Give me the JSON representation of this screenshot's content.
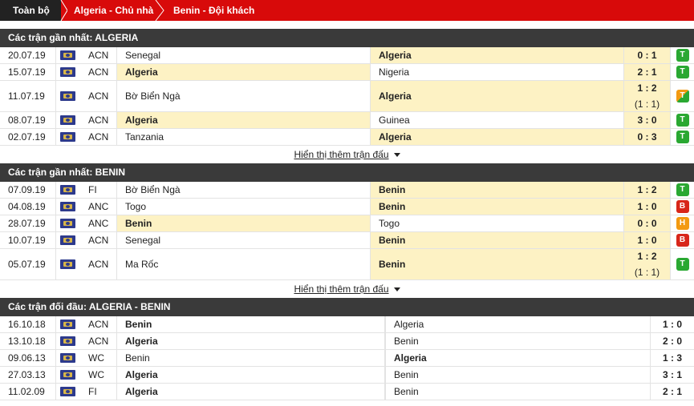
{
  "tabs": [
    {
      "label": "Toàn bộ"
    },
    {
      "label": "Algeria - Chủ nhà"
    },
    {
      "label": "Benin - Đội khách"
    }
  ],
  "sections": [
    {
      "title": "Các trận gần nhất: ALGERIA",
      "more": "Hiển thị thêm trận đấu",
      "rows": [
        {
          "date": "20.07.19",
          "league": "ACN",
          "home": "Senegal",
          "away": "Algeria",
          "score": "0 : 1",
          "sub": "",
          "result": "T",
          "hl": "away"
        },
        {
          "date": "15.07.19",
          "league": "ACN",
          "home": "Algeria",
          "away": "Nigeria",
          "score": "2 : 1",
          "sub": "",
          "result": "T",
          "hl": "home"
        },
        {
          "date": "11.07.19",
          "league": "ACN",
          "home": "Bờ Biển Ngà",
          "away": "Algeria",
          "score": "1 : 2",
          "sub": "(1 : 1)",
          "result": "T",
          "hl": "away"
        },
        {
          "date": "08.07.19",
          "league": "ACN",
          "home": "Algeria",
          "away": "Guinea",
          "score": "3 : 0",
          "sub": "",
          "result": "T",
          "hl": "home"
        },
        {
          "date": "02.07.19",
          "league": "ACN",
          "home": "Tanzania",
          "away": "Algeria",
          "score": "0 : 3",
          "sub": "",
          "result": "T",
          "hl": "away"
        }
      ]
    },
    {
      "title": "Các trận gần nhất: BENIN",
      "more": "Hiển thị thêm trận đấu",
      "rows": [
        {
          "date": "07.09.19",
          "league": "FI",
          "home": "Bờ Biển Ngà",
          "away": "Benin",
          "score": "1 : 2",
          "sub": "",
          "result": "T",
          "hl": "away"
        },
        {
          "date": "04.08.19",
          "league": "ANC",
          "home": "Togo",
          "away": "Benin",
          "score": "1 : 0",
          "sub": "",
          "result": "B",
          "hl": "away"
        },
        {
          "date": "28.07.19",
          "league": "ANC",
          "home": "Benin",
          "away": "Togo",
          "score": "0 : 0",
          "sub": "",
          "result": "H",
          "hl": "home"
        },
        {
          "date": "10.07.19",
          "league": "ACN",
          "home": "Senegal",
          "away": "Benin",
          "score": "1 : 0",
          "sub": "",
          "result": "B",
          "hl": "away"
        },
        {
          "date": "05.07.19",
          "league": "ACN",
          "home": "Ma Rốc",
          "away": "Benin",
          "score": "1 : 2",
          "sub": "(1 : 1)",
          "result": "T",
          "hl": "away"
        }
      ]
    }
  ],
  "h2h": {
    "title": "Các trận đối đầu: ALGERIA - BENIN",
    "rows": [
      {
        "date": "16.10.18",
        "league": "ACN",
        "home": "Benin",
        "away": "Algeria",
        "score": "1 : 0"
      },
      {
        "date": "13.10.18",
        "league": "ACN",
        "home": "Algeria",
        "away": "Benin",
        "score": "2 : 0"
      },
      {
        "date": "09.06.13",
        "league": "WC",
        "home": "Benin",
        "away": "Algeria",
        "score": "1 : 3"
      },
      {
        "date": "27.03.13",
        "league": "WC",
        "home": "Algeria",
        "away": "Benin",
        "score": "3 : 1"
      },
      {
        "date": "11.02.09",
        "league": "FI",
        "home": "Algeria",
        "away": "Benin",
        "score": "2 : 1"
      }
    ]
  },
  "colors": {
    "accent": "#d80a0a",
    "header": "#3a3a3a",
    "highlight": "#fdf2c4",
    "win": "#2aa832",
    "loss": "#d8261a",
    "draw": "#f39a12"
  }
}
